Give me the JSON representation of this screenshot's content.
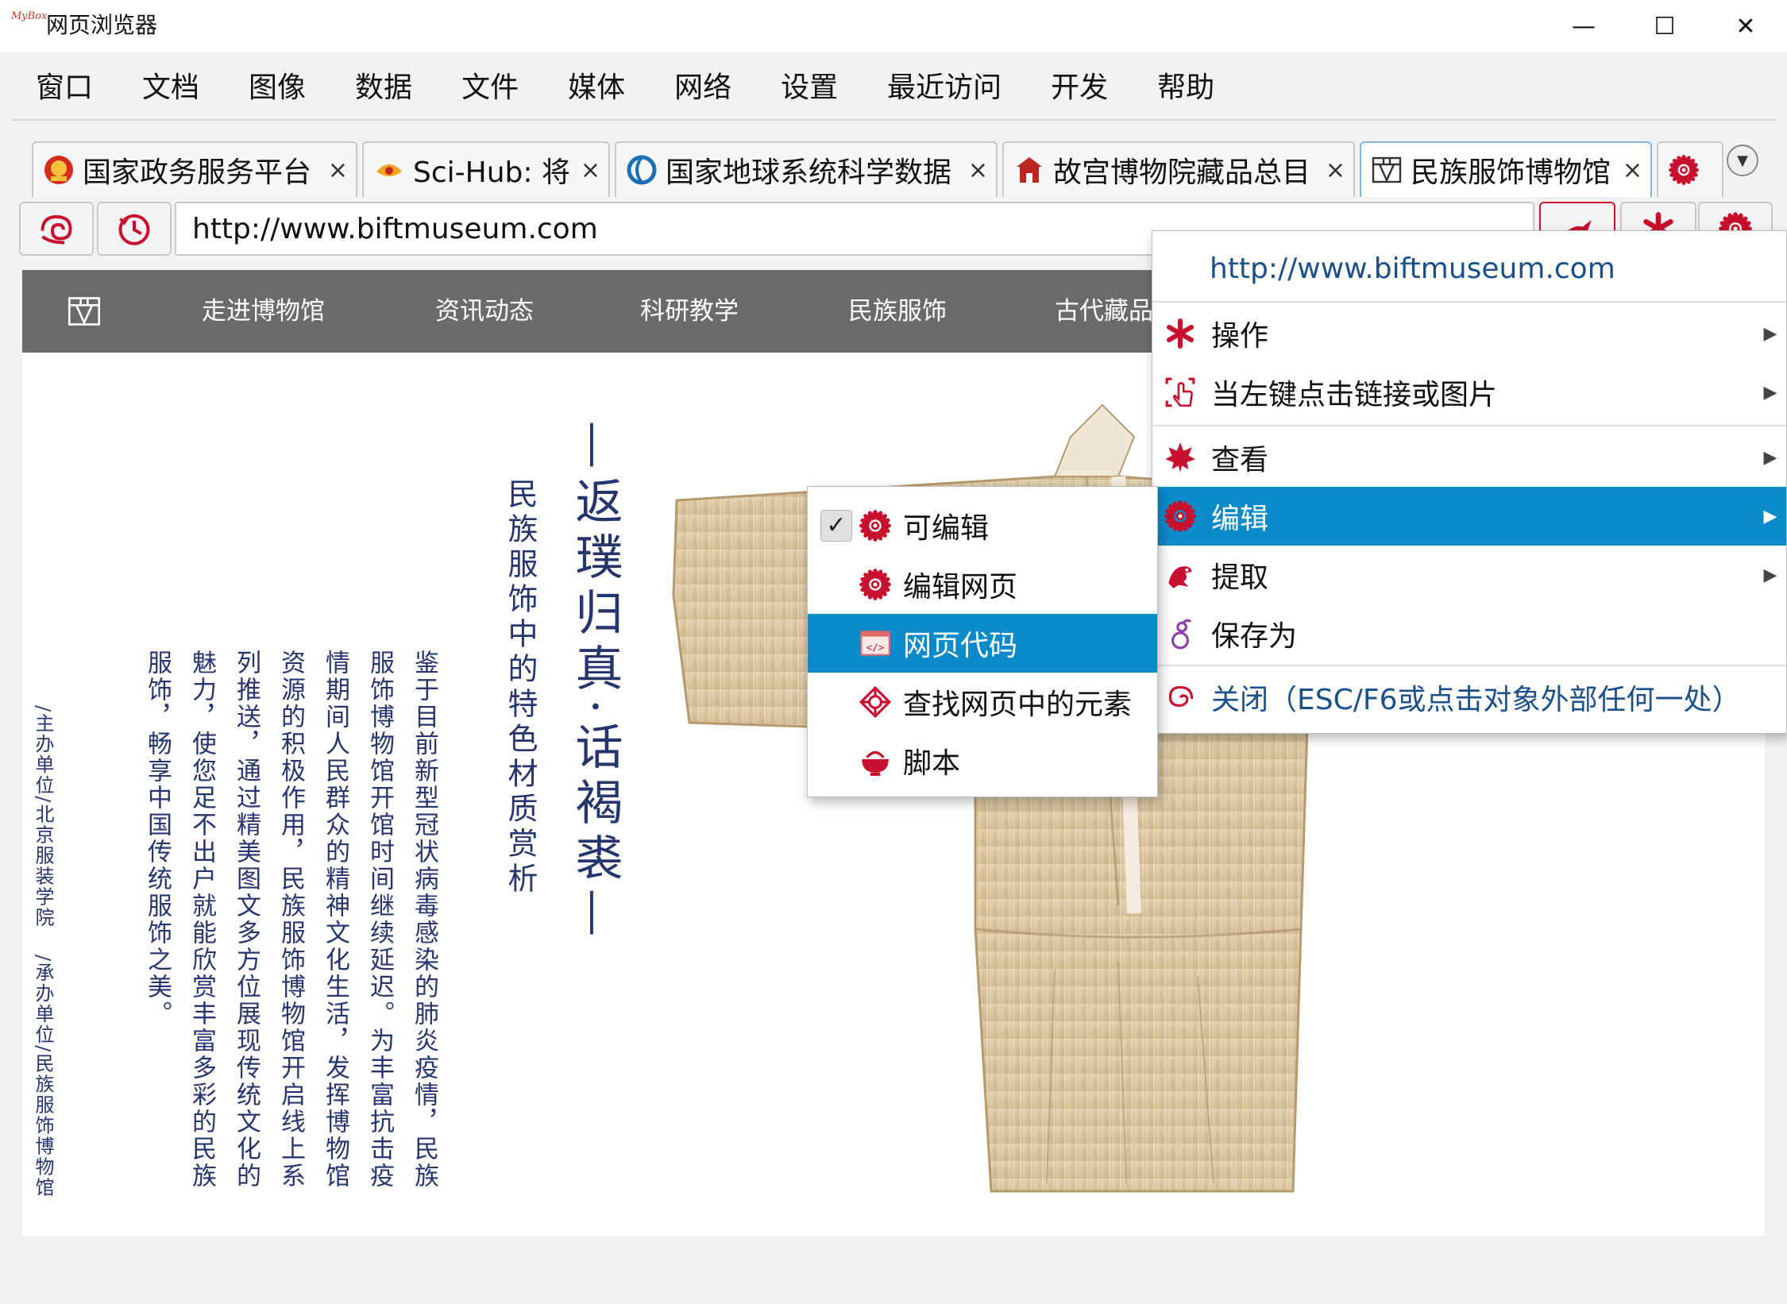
{
  "app": {
    "title": "网页浏览器",
    "logo_text": "MyBox"
  },
  "window_controls": {
    "minimize": "—",
    "maximize": "☐",
    "close": "✕"
  },
  "menubar": {
    "items": [
      "窗口",
      "文档",
      "图像",
      "数据",
      "文件",
      "媒体",
      "网络",
      "设置",
      "最近访问",
      "开发",
      "帮助"
    ]
  },
  "tabs": [
    {
      "label": "国家政务服务平台",
      "close": "×"
    },
    {
      "label": "Sci-Hub: 将",
      "close": "×"
    },
    {
      "label": "国家地球系统科学数据",
      "close": "×"
    },
    {
      "label": "故宫博物院藏品总目",
      "close": "×"
    },
    {
      "label": "民族服饰博物馆",
      "close": "×",
      "active": true
    }
  ],
  "tab_more_glyph": "▼",
  "address": {
    "url": "http://www.biftmuseum.com"
  },
  "site": {
    "nav": [
      "走进博物馆",
      "资讯动态",
      "科研教学",
      "民族服饰",
      "古代藏品"
    ],
    "hero_title": "—返璞归真·话褐裘—",
    "hero_subtitle": "民族服饰中的特色材质赏析",
    "intro_columns": [
      "鉴于目前新型冠状病毒感染的肺炎疫情，民族",
      "服饰博物馆开馆时间继续延迟。为丰富抗击疫",
      "情期间人民群众的精神文化生活，发挥博物馆",
      "资源的积极作用，民族服饰博物馆开启线上系",
      "列推送，通过精美图文多方位展现传统文化的",
      "魅力，使您足不出户就能欣赏丰富多彩的民族",
      "服饰，畅享中国传统服饰之美。"
    ],
    "organizer": "/主办单位/北京服装学院",
    "co_organizer": "/承办单位/民族服饰博物馆"
  },
  "context_menu": {
    "header_url": "http://www.biftmuseum.com",
    "items": [
      {
        "label": "操作",
        "icon": "asterisk-icon",
        "submenu": true
      },
      {
        "label": "当左键点击链接或图片",
        "icon": "click-icon",
        "submenu": true
      },
      {
        "label": "查看",
        "icon": "maple-leaf-icon",
        "submenu": true
      },
      {
        "label": "编辑",
        "icon": "flower-icon",
        "submenu": true,
        "highlighted": true
      },
      {
        "label": "提取",
        "icon": "dragon-icon",
        "submenu": true
      },
      {
        "label": "保存为",
        "icon": "gourd-icon",
        "submenu": false
      },
      {
        "label": "关闭（ESC/F6或点击对象外部任何一处）",
        "icon": "spiral-icon",
        "submenu": false
      }
    ],
    "submenu_arrow": "▶"
  },
  "edit_submenu": {
    "items": [
      {
        "label": "可编辑",
        "checked": true,
        "icon": "flower-icon"
      },
      {
        "label": "编辑网页",
        "icon": "flower-icon"
      },
      {
        "label": "网页代码",
        "icon": "code-icon",
        "highlighted": true
      },
      {
        "label": "查找网页中的元素",
        "icon": "locate-icon"
      },
      {
        "label": "脚本",
        "icon": "bowl-icon"
      }
    ],
    "check_glyph": "✓"
  },
  "colors": {
    "accent": "#0a8bc9",
    "icon_red": "#c8102e",
    "site_nav_bg": "#6b6b6b",
    "calligraphy_blue": "#27356e"
  }
}
